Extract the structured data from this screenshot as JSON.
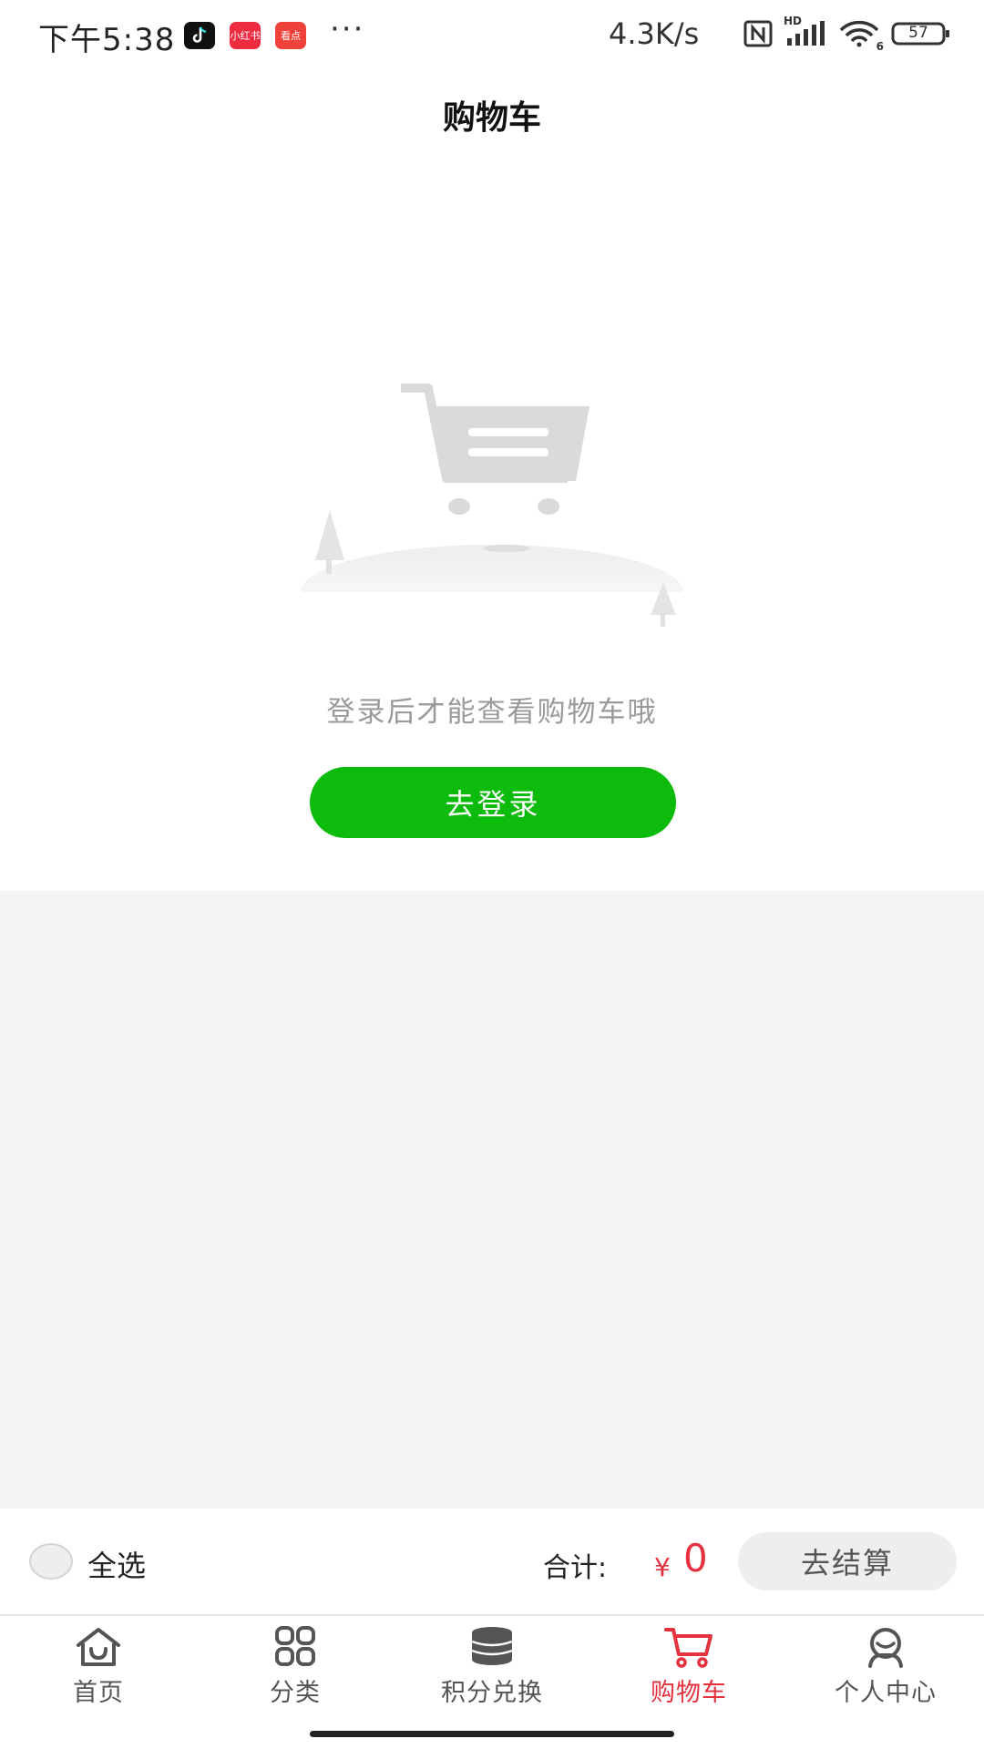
{
  "status_bar": {
    "time": "下午5:38",
    "app_icons": [
      "tiktok-icon",
      "xiaohongshu-icon",
      "kandian-icon"
    ],
    "app_icon_labels": [
      "",
      "小红书",
      "看点"
    ],
    "more": "···",
    "net_speed": "4.3K/s",
    "signal_label": "HD",
    "wifi_label": "6",
    "battery": "57"
  },
  "header": {
    "title": "购物车"
  },
  "empty_state": {
    "illustration": "empty-cart-illustration",
    "message": "登录后才能查看购物车哦",
    "login_button": "去登录"
  },
  "checkout": {
    "select_all": "全选",
    "total_label": "合计:",
    "currency": "¥",
    "total_value": "0",
    "checkout_button": "去结算"
  },
  "tab_bar": {
    "tabs": [
      {
        "label": "首页",
        "icon": "home-icon"
      },
      {
        "label": "分类",
        "icon": "grid-icon"
      },
      {
        "label": "积分兑换",
        "icon": "coins-icon"
      },
      {
        "label": "购物车",
        "icon": "cart-icon"
      },
      {
        "label": "个人中心",
        "icon": "user-icon"
      }
    ],
    "active": "购物车"
  },
  "colors": {
    "primary_green": "#0cbb0c",
    "accent_red": "#e5323e",
    "background_gray": "#f5f5f5"
  }
}
